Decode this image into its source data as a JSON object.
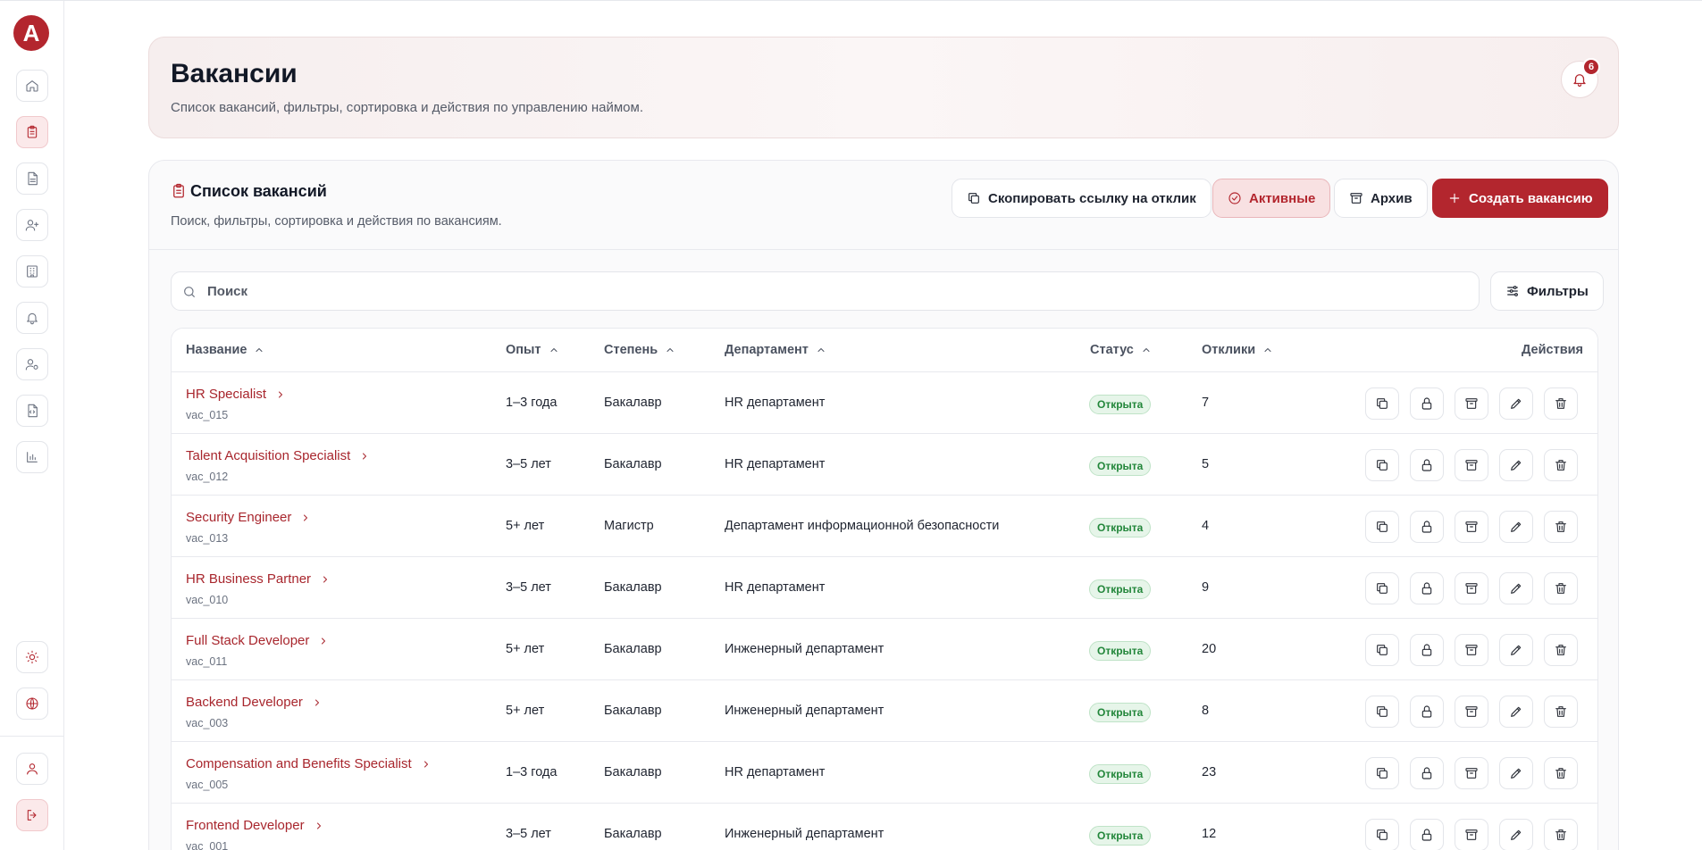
{
  "header": {
    "title": "Вакансии",
    "subtitle": "Список вакансий, фильтры, сортировка и действия по управлению наймом.",
    "notifications_count": "6"
  },
  "list": {
    "title": "Список вакансий",
    "subtitle": "Поиск, фильтры, сортировка и действия по вакансиям.",
    "copy_link_label": "Скопировать ссылку на отклик",
    "active_label": "Активные",
    "archive_label": "Архив",
    "create_label": "Создать вакансию",
    "search_placeholder": "Поиск",
    "filters_label": "Фильтры"
  },
  "table": {
    "columns": {
      "name": "Название",
      "experience": "Опыт",
      "degree": "Степень",
      "department": "Департамент",
      "status": "Статус",
      "responses": "Отклики",
      "actions": "Действия"
    },
    "rows": [
      {
        "name": "HR Specialist",
        "id": "vac_015",
        "experience": "1–3 года",
        "degree": "Бакалавр",
        "department": "HR департамент",
        "status": "Открыта",
        "responses": "7"
      },
      {
        "name": "Talent Acquisition Specialist",
        "id": "vac_012",
        "experience": "3–5 лет",
        "degree": "Бакалавр",
        "department": "HR департамент",
        "status": "Открыта",
        "responses": "5"
      },
      {
        "name": "Security Engineer",
        "id": "vac_013",
        "experience": "5+ лет",
        "degree": "Магистр",
        "department": "Департамент информационной безопасности",
        "status": "Открыта",
        "responses": "4"
      },
      {
        "name": "HR Business Partner",
        "id": "vac_010",
        "experience": "3–5 лет",
        "degree": "Бакалавр",
        "department": "HR департамент",
        "status": "Открыта",
        "responses": "9"
      },
      {
        "name": "Full Stack Developer",
        "id": "vac_011",
        "experience": "5+ лет",
        "degree": "Бакалавр",
        "department": "Инженерный департамент",
        "status": "Открыта",
        "responses": "20"
      },
      {
        "name": "Backend Developer",
        "id": "vac_003",
        "experience": "5+ лет",
        "degree": "Бакалавр",
        "department": "Инженерный департамент",
        "status": "Открыта",
        "responses": "8"
      },
      {
        "name": "Compensation and Benefits Specialist",
        "id": "vac_005",
        "experience": "1–3 года",
        "degree": "Бакалавр",
        "department": "HR департамент",
        "status": "Открыта",
        "responses": "23"
      },
      {
        "name": "Frontend Developer",
        "id": "vac_001",
        "experience": "3–5 лет",
        "degree": "Бакалавр",
        "department": "Инженерный департамент",
        "status": "Открыта",
        "responses": "12"
      }
    ]
  },
  "icons": {
    "sidebar": [
      "home-icon",
      "clipboard-icon",
      "document-icon",
      "user-plus-icon",
      "building-icon",
      "bell-icon",
      "user-settings-icon",
      "file-code-icon",
      "bar-chart-icon"
    ],
    "sidebar_bottom": [
      "sun-icon",
      "globe-icon",
      "user-icon",
      "logout-icon"
    ],
    "row_actions": [
      "copy-icon",
      "lock-icon",
      "archive-icon",
      "edit-icon",
      "trash-icon"
    ]
  },
  "colors": {
    "brand": "#b3262e",
    "status_open_bg": "#e6f5e9",
    "status_open_text": "#22863a"
  }
}
